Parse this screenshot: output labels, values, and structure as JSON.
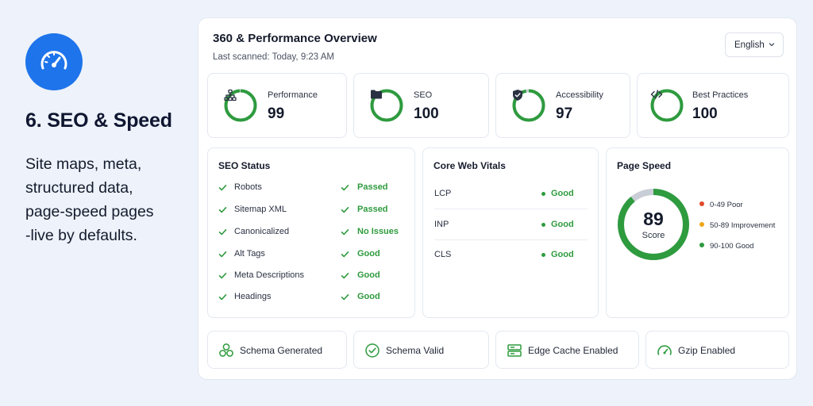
{
  "hero": {
    "icon": "speedometer-icon",
    "title": "6. SEO & Speed",
    "desc_lines": [
      "Site maps, meta,",
      "structured data,",
      "page-speed pages",
      "-live by defaults."
    ],
    "accent": "#1e74ea"
  },
  "panel": {
    "title": "360 & Performance Overview",
    "subtitle": "Last scanned: Today, 9:23 AM",
    "language": "English"
  },
  "scores": [
    {
      "label": "Performance",
      "value": "99",
      "percent": 99,
      "icon": "sitemap-icon"
    },
    {
      "label": "SEO",
      "value": "100",
      "percent": 100,
      "icon": "folder-icon"
    },
    {
      "label": "Accessibility",
      "value": "97",
      "percent": 97,
      "icon": "shield-check-icon"
    },
    {
      "label": "Best Practices",
      "value": "100",
      "percent": 100,
      "icon": "code-icon"
    }
  ],
  "seo_status": {
    "title": "SEO Status",
    "rows": [
      {
        "name": "Robots",
        "status": "Passed"
      },
      {
        "name": "Sitemap XML",
        "status": "Passed"
      },
      {
        "name": "Canonicalized",
        "status": "No Issues"
      },
      {
        "name": "Alt Tags",
        "status": "Good"
      },
      {
        "name": "Meta Descriptions",
        "status": "Good"
      },
      {
        "name": "Headings",
        "status": "Good"
      }
    ]
  },
  "core_web_vitals": {
    "title": "Core Web Vitals",
    "rows": [
      {
        "metric": "LCP",
        "value": "Good"
      },
      {
        "metric": "INP",
        "value": "Good"
      },
      {
        "metric": "CLS",
        "value": "Good"
      }
    ]
  },
  "page_speed": {
    "title": "Page Speed",
    "score": "89",
    "score_percent": 89,
    "score_label": "Score",
    "legend": [
      {
        "label": "0-49 Poor",
        "color": "#e2492b"
      },
      {
        "label": "50-89 Improvement",
        "color": "#f0a419"
      },
      {
        "label": "90-100 Good",
        "color": "#2e9b3e"
      }
    ]
  },
  "features": [
    {
      "label": "Schema Generated",
      "icon": "hexagons-icon"
    },
    {
      "label": "Schema Valid",
      "icon": "check-circle-icon"
    },
    {
      "label": "Edge Cache Enabled",
      "icon": "server-icon"
    },
    {
      "label": "Gzip Enabled",
      "icon": "gauge-icon"
    }
  ],
  "colors": {
    "good": "#2e9b3e",
    "ring_track": "#c9ced6",
    "background": "#edf2fb"
  }
}
